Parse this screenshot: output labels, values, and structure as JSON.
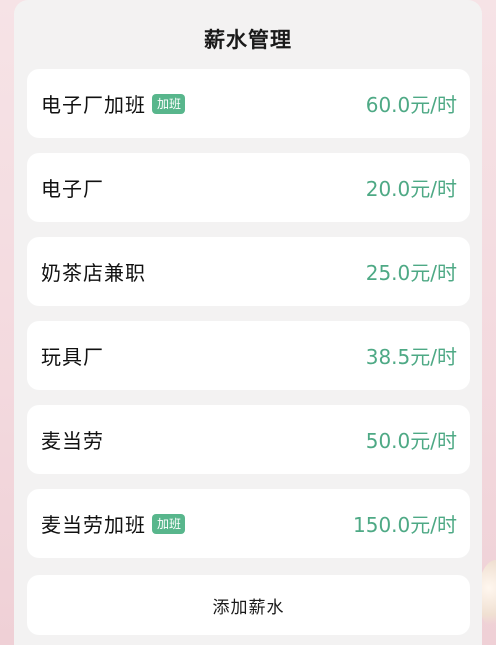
{
  "header": {
    "title": "薪水管理"
  },
  "salaries": [
    {
      "name": "电子厂加班",
      "badge": "加班",
      "rate": "60.0元/时"
    },
    {
      "name": "电子厂",
      "badge": "",
      "rate": "20.0元/时"
    },
    {
      "name": "奶茶店兼职",
      "badge": "",
      "rate": "25.0元/时"
    },
    {
      "name": "玩具厂",
      "badge": "",
      "rate": "38.5元/时"
    },
    {
      "name": "麦当劳",
      "badge": "",
      "rate": "50.0元/时"
    },
    {
      "name": "麦当劳加班",
      "badge": "加班",
      "rate": "150.0元/时"
    }
  ],
  "actions": {
    "add_label": "添加薪水"
  },
  "colors": {
    "accent": "#4ea985",
    "badge_bg": "#58b68c",
    "sheet_bg": "#f3f2f2",
    "backdrop": "#f3d9de"
  }
}
